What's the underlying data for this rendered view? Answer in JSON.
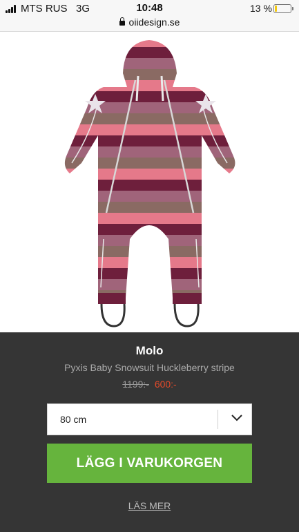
{
  "status_bar": {
    "carrier": "MTS RUS",
    "network": "3G",
    "time": "10:48",
    "battery_percent": "13 %",
    "battery_level": 0.13
  },
  "browser": {
    "url": "oiidesign.se"
  },
  "gallery": {
    "active_dot_color": "#e9d22c"
  },
  "product": {
    "brand": "Molo",
    "name": "Pyxis Baby Snowsuit Huckleberry stripe",
    "old_price": "1199:-",
    "new_price": "600:-"
  },
  "size_select": {
    "selected": "80 cm"
  },
  "actions": {
    "add_to_cart_label": "LÄGG I VARUKORGEN",
    "read_more_label": "LÄS MER"
  },
  "colors": {
    "panel_bg": "#353535",
    "button_green": "#66b43d",
    "sale_red": "#e24a2a"
  },
  "icons": {
    "lock": "lock-icon",
    "chevron": "chevron-down-icon",
    "signal": "signal-icon",
    "battery": "battery-icon"
  }
}
